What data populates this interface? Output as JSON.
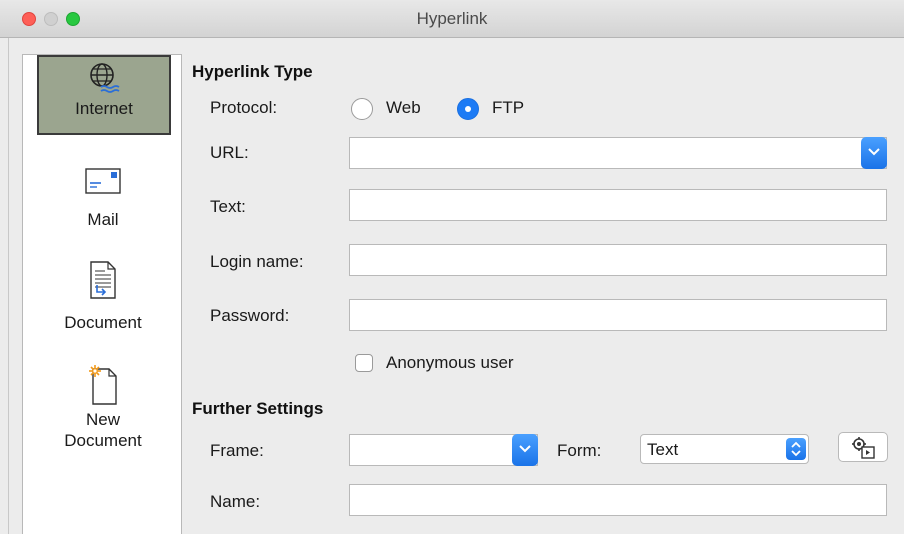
{
  "window": {
    "title": "Hyperlink"
  },
  "sidebar": {
    "items": [
      {
        "label": "Internet",
        "icon": "globe-icon",
        "selected": true
      },
      {
        "label": "Mail",
        "icon": "envelope-icon",
        "selected": false
      },
      {
        "label": "Document",
        "icon": "document-icon",
        "selected": false
      },
      {
        "label": "New",
        "label2": "Document",
        "icon": "new-document-icon",
        "selected": false
      }
    ]
  },
  "hyperlink_type": {
    "heading": "Hyperlink Type",
    "protocol_label": "Protocol:",
    "protocol_options": [
      {
        "label": "Web",
        "selected": false
      },
      {
        "label": "FTP",
        "selected": true
      }
    ],
    "url_label": "URL:",
    "url_value": "",
    "text_label": "Text:",
    "text_value": "",
    "login_label": "Login name:",
    "login_value": "",
    "password_label": "Password:",
    "password_value": "",
    "anonymous_label": "Anonymous user",
    "anonymous_checked": false
  },
  "further_settings": {
    "heading": "Further Settings",
    "frame_label": "Frame:",
    "frame_value": "",
    "form_label": "Form:",
    "form_value": "Text",
    "events_icon": "events-icon",
    "name_label": "Name:",
    "name_value": ""
  },
  "colors": {
    "accent": "#1d7bf5",
    "selected_item_bg": "#9ba58f"
  }
}
